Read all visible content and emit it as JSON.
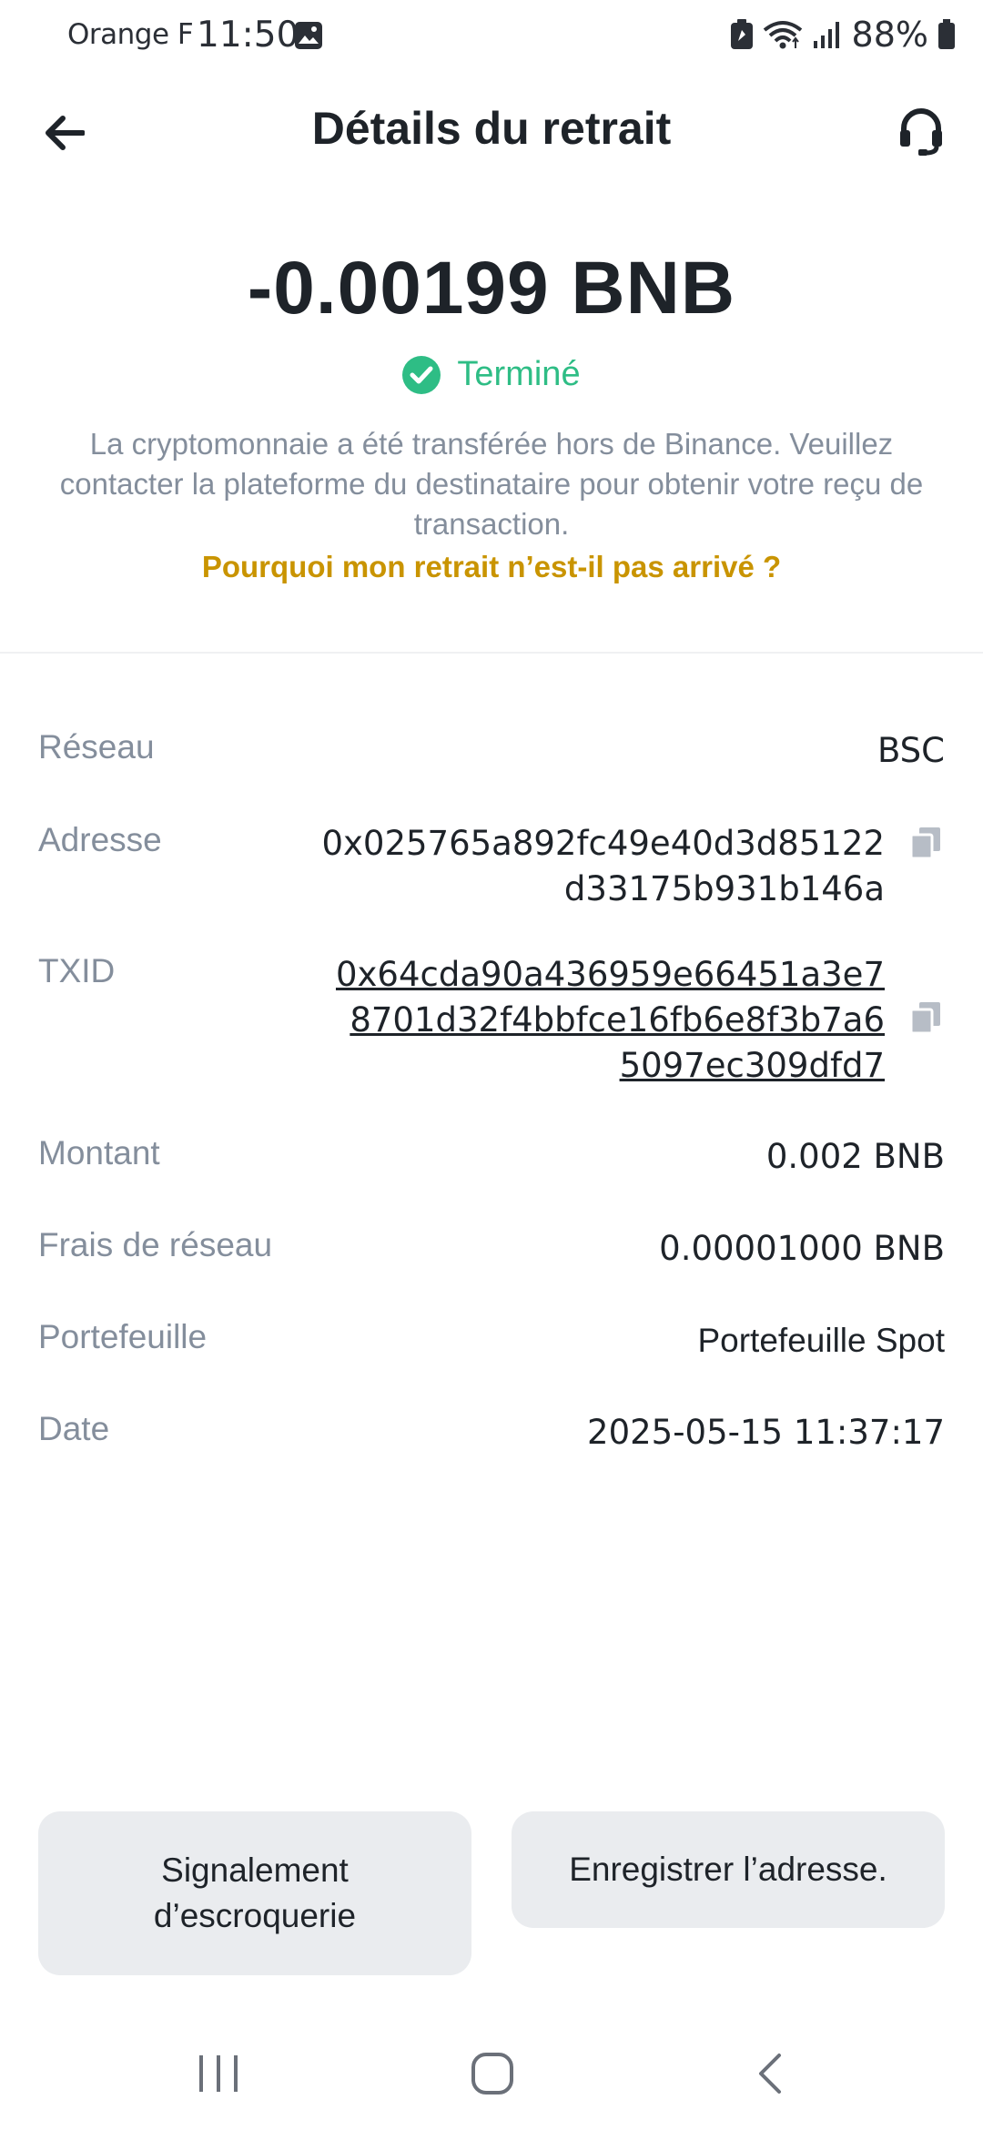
{
  "status_bar": {
    "carrier": "Orange F",
    "time": "11:50",
    "battery": "88%",
    "icons": [
      "gallery-icon",
      "battery-saver-icon",
      "wifi-icon",
      "signal-icon",
      "battery-icon"
    ]
  },
  "header": {
    "title": "Détails du retrait",
    "back_icon": "arrow-left-icon",
    "support_icon": "headset-icon"
  },
  "transaction": {
    "amount": "-0.00199 BNB",
    "status": "Terminé",
    "status_color": "#2ebd85",
    "description": "La cryptomonnaie a été transférée hors de Binance. Veuillez contacter la plateforme du destinataire pour obtenir votre reçu de transaction.",
    "help_link": "Pourquoi mon retrait n’est-il pas arrivé ?",
    "help_link_color": "#c99400"
  },
  "details": {
    "network": {
      "label": "Réseau",
      "value": "BSC"
    },
    "address": {
      "label": "Adresse",
      "line1": "0x025765a892fc49e40d3d85122",
      "line2": "d33175b931b146a"
    },
    "txid": {
      "label": "TXID",
      "line1": "0x64cda90a436959e66451a3e7",
      "line2": "8701d32f4bbfce16fb6e8f3b7a6",
      "line3": "5097ec309dfd7"
    },
    "amount": {
      "label": "Montant",
      "value": "0.002 BNB"
    },
    "fee": {
      "label": "Frais de réseau",
      "value": "0.00001000 BNB"
    },
    "wallet": {
      "label": "Portefeuille",
      "value": "Portefeuille Spot"
    },
    "date": {
      "label": "Date",
      "value": "2025-05-15 11:37:17"
    }
  },
  "actions": {
    "report_line1": "Signalement",
    "report_line2": "d’escroquerie",
    "save_address": "Enregistrer l’adresse."
  },
  "nav": {
    "icons": [
      "recent-apps-icon",
      "home-icon",
      "back-nav-icon"
    ]
  }
}
